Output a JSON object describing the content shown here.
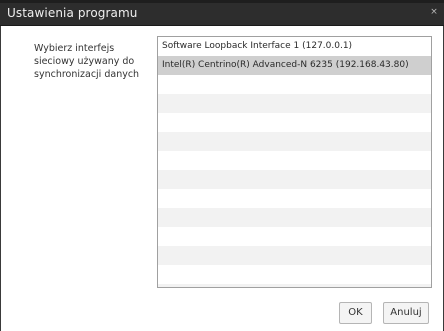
{
  "window": {
    "title": "Ustawienia programu",
    "close_glyph": "×"
  },
  "form": {
    "label": "Wybierz interfejs sieciowy używany do synchronizacji danych"
  },
  "interfaces": {
    "selected_index": 1,
    "items": [
      "Software Loopback Interface 1 (127.0.0.1)",
      "Intel(R) Centrino(R) Advanced-N 6235 (192.168.43.80)"
    ]
  },
  "buttons": {
    "ok_label": "OK",
    "cancel_label": "Anuluj"
  }
}
